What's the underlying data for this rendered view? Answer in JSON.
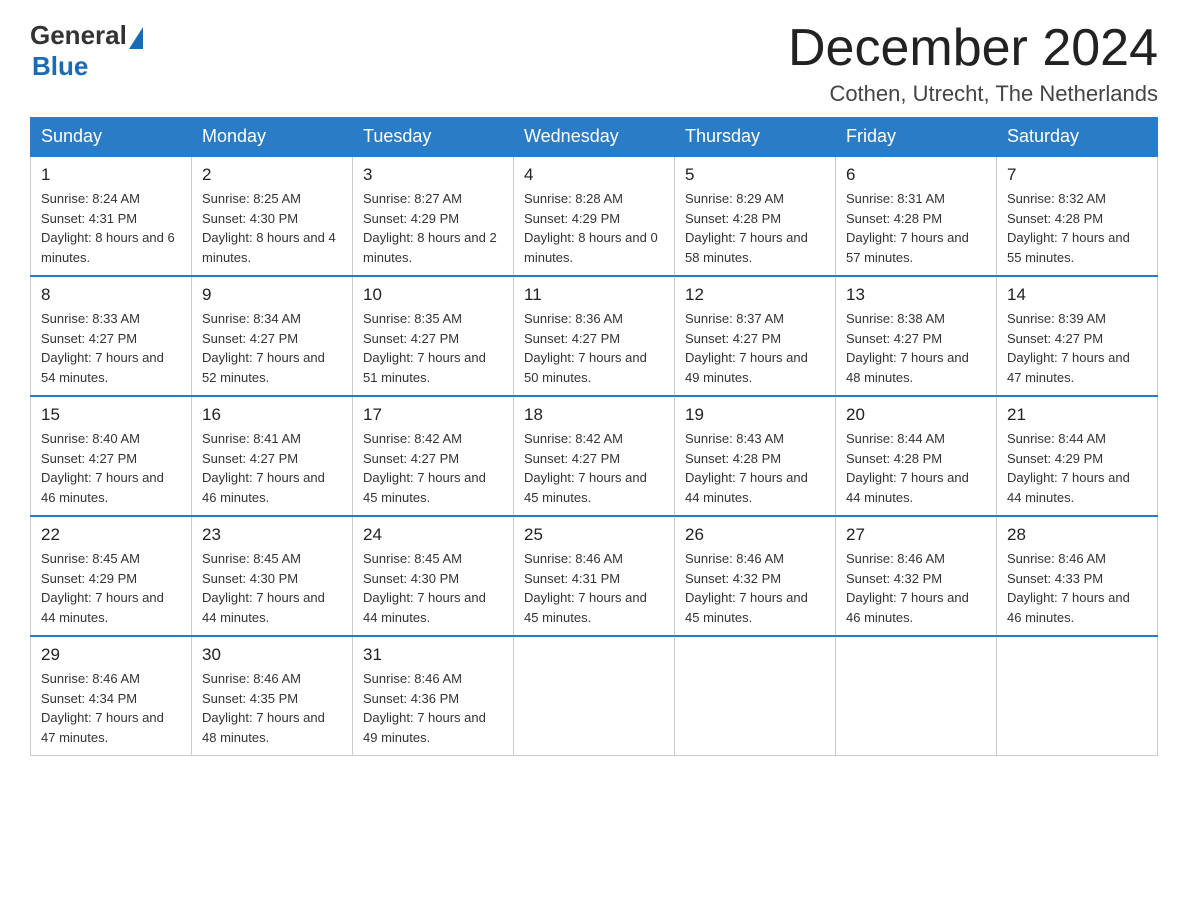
{
  "header": {
    "logo_general": "General",
    "logo_blue": "Blue",
    "month_year": "December 2024",
    "location": "Cothen, Utrecht, The Netherlands"
  },
  "days_of_week": [
    "Sunday",
    "Monday",
    "Tuesday",
    "Wednesday",
    "Thursday",
    "Friday",
    "Saturday"
  ],
  "weeks": [
    [
      {
        "day": "1",
        "sunrise": "8:24 AM",
        "sunset": "4:31 PM",
        "daylight": "8 hours and 6 minutes."
      },
      {
        "day": "2",
        "sunrise": "8:25 AM",
        "sunset": "4:30 PM",
        "daylight": "8 hours and 4 minutes."
      },
      {
        "day": "3",
        "sunrise": "8:27 AM",
        "sunset": "4:29 PM",
        "daylight": "8 hours and 2 minutes."
      },
      {
        "day": "4",
        "sunrise": "8:28 AM",
        "sunset": "4:29 PM",
        "daylight": "8 hours and 0 minutes."
      },
      {
        "day": "5",
        "sunrise": "8:29 AM",
        "sunset": "4:28 PM",
        "daylight": "7 hours and 58 minutes."
      },
      {
        "day": "6",
        "sunrise": "8:31 AM",
        "sunset": "4:28 PM",
        "daylight": "7 hours and 57 minutes."
      },
      {
        "day": "7",
        "sunrise": "8:32 AM",
        "sunset": "4:28 PM",
        "daylight": "7 hours and 55 minutes."
      }
    ],
    [
      {
        "day": "8",
        "sunrise": "8:33 AM",
        "sunset": "4:27 PM",
        "daylight": "7 hours and 54 minutes."
      },
      {
        "day": "9",
        "sunrise": "8:34 AM",
        "sunset": "4:27 PM",
        "daylight": "7 hours and 52 minutes."
      },
      {
        "day": "10",
        "sunrise": "8:35 AM",
        "sunset": "4:27 PM",
        "daylight": "7 hours and 51 minutes."
      },
      {
        "day": "11",
        "sunrise": "8:36 AM",
        "sunset": "4:27 PM",
        "daylight": "7 hours and 50 minutes."
      },
      {
        "day": "12",
        "sunrise": "8:37 AM",
        "sunset": "4:27 PM",
        "daylight": "7 hours and 49 minutes."
      },
      {
        "day": "13",
        "sunrise": "8:38 AM",
        "sunset": "4:27 PM",
        "daylight": "7 hours and 48 minutes."
      },
      {
        "day": "14",
        "sunrise": "8:39 AM",
        "sunset": "4:27 PM",
        "daylight": "7 hours and 47 minutes."
      }
    ],
    [
      {
        "day": "15",
        "sunrise": "8:40 AM",
        "sunset": "4:27 PM",
        "daylight": "7 hours and 46 minutes."
      },
      {
        "day": "16",
        "sunrise": "8:41 AM",
        "sunset": "4:27 PM",
        "daylight": "7 hours and 46 minutes."
      },
      {
        "day": "17",
        "sunrise": "8:42 AM",
        "sunset": "4:27 PM",
        "daylight": "7 hours and 45 minutes."
      },
      {
        "day": "18",
        "sunrise": "8:42 AM",
        "sunset": "4:27 PM",
        "daylight": "7 hours and 45 minutes."
      },
      {
        "day": "19",
        "sunrise": "8:43 AM",
        "sunset": "4:28 PM",
        "daylight": "7 hours and 44 minutes."
      },
      {
        "day": "20",
        "sunrise": "8:44 AM",
        "sunset": "4:28 PM",
        "daylight": "7 hours and 44 minutes."
      },
      {
        "day": "21",
        "sunrise": "8:44 AM",
        "sunset": "4:29 PM",
        "daylight": "7 hours and 44 minutes."
      }
    ],
    [
      {
        "day": "22",
        "sunrise": "8:45 AM",
        "sunset": "4:29 PM",
        "daylight": "7 hours and 44 minutes."
      },
      {
        "day": "23",
        "sunrise": "8:45 AM",
        "sunset": "4:30 PM",
        "daylight": "7 hours and 44 minutes."
      },
      {
        "day": "24",
        "sunrise": "8:45 AM",
        "sunset": "4:30 PM",
        "daylight": "7 hours and 44 minutes."
      },
      {
        "day": "25",
        "sunrise": "8:46 AM",
        "sunset": "4:31 PM",
        "daylight": "7 hours and 45 minutes."
      },
      {
        "day": "26",
        "sunrise": "8:46 AM",
        "sunset": "4:32 PM",
        "daylight": "7 hours and 45 minutes."
      },
      {
        "day": "27",
        "sunrise": "8:46 AM",
        "sunset": "4:32 PM",
        "daylight": "7 hours and 46 minutes."
      },
      {
        "day": "28",
        "sunrise": "8:46 AM",
        "sunset": "4:33 PM",
        "daylight": "7 hours and 46 minutes."
      }
    ],
    [
      {
        "day": "29",
        "sunrise": "8:46 AM",
        "sunset": "4:34 PM",
        "daylight": "7 hours and 47 minutes."
      },
      {
        "day": "30",
        "sunrise": "8:46 AM",
        "sunset": "4:35 PM",
        "daylight": "7 hours and 48 minutes."
      },
      {
        "day": "31",
        "sunrise": "8:46 AM",
        "sunset": "4:36 PM",
        "daylight": "7 hours and 49 minutes."
      },
      null,
      null,
      null,
      null
    ]
  ],
  "labels": {
    "sunrise": "Sunrise:",
    "sunset": "Sunset:",
    "daylight": "Daylight:"
  }
}
